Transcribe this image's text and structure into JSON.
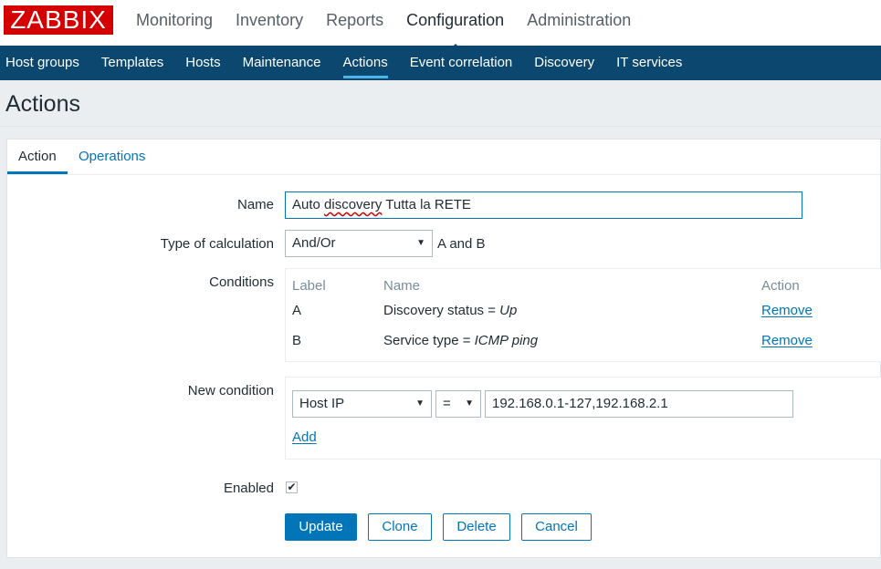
{
  "logo": "ZABBIX",
  "top_menu": [
    {
      "label": "Monitoring"
    },
    {
      "label": "Inventory"
    },
    {
      "label": "Reports"
    },
    {
      "label": "Configuration",
      "selected": true
    },
    {
      "label": "Administration"
    }
  ],
  "sub_menu": [
    {
      "label": "Host groups"
    },
    {
      "label": "Templates"
    },
    {
      "label": "Hosts"
    },
    {
      "label": "Maintenance"
    },
    {
      "label": "Actions",
      "selected": true
    },
    {
      "label": "Event correlation"
    },
    {
      "label": "Discovery"
    },
    {
      "label": "IT services"
    }
  ],
  "page_title": "Actions",
  "tabs": [
    {
      "label": "Action",
      "selected": true
    },
    {
      "label": "Operations"
    }
  ],
  "form": {
    "name_label": "Name",
    "name_value_part1": "Auto ",
    "name_value_misspelled": "discovery",
    "name_value_part2": " Tutta la RETE",
    "calc_label": "Type of calculation",
    "calc_value": "And/Or",
    "calc_formula": "A and B",
    "conditions_label": "Conditions",
    "conditions_headers": {
      "label": "Label",
      "name": "Name",
      "action": "Action"
    },
    "conditions": [
      {
        "label": "A",
        "name_prefix": "Discovery status = ",
        "name_value": "Up",
        "action": "Remove"
      },
      {
        "label": "B",
        "name_prefix": "Service type = ",
        "name_value": "ICMP ping",
        "action": "Remove"
      }
    ],
    "new_condition_label": "New condition",
    "new_condition_type": "Host IP",
    "new_condition_operator": "=",
    "new_condition_value": "192.168.0.1-127,192.168.2.1",
    "add_label": "Add",
    "enabled_label": "Enabled",
    "enabled_checked": true
  },
  "buttons": {
    "update": "Update",
    "clone": "Clone",
    "delete": "Delete",
    "cancel": "Cancel"
  },
  "colors": {
    "brand_red": "#d40000",
    "nav_blue": "#0b476e",
    "accent_blue": "#0275b8"
  }
}
